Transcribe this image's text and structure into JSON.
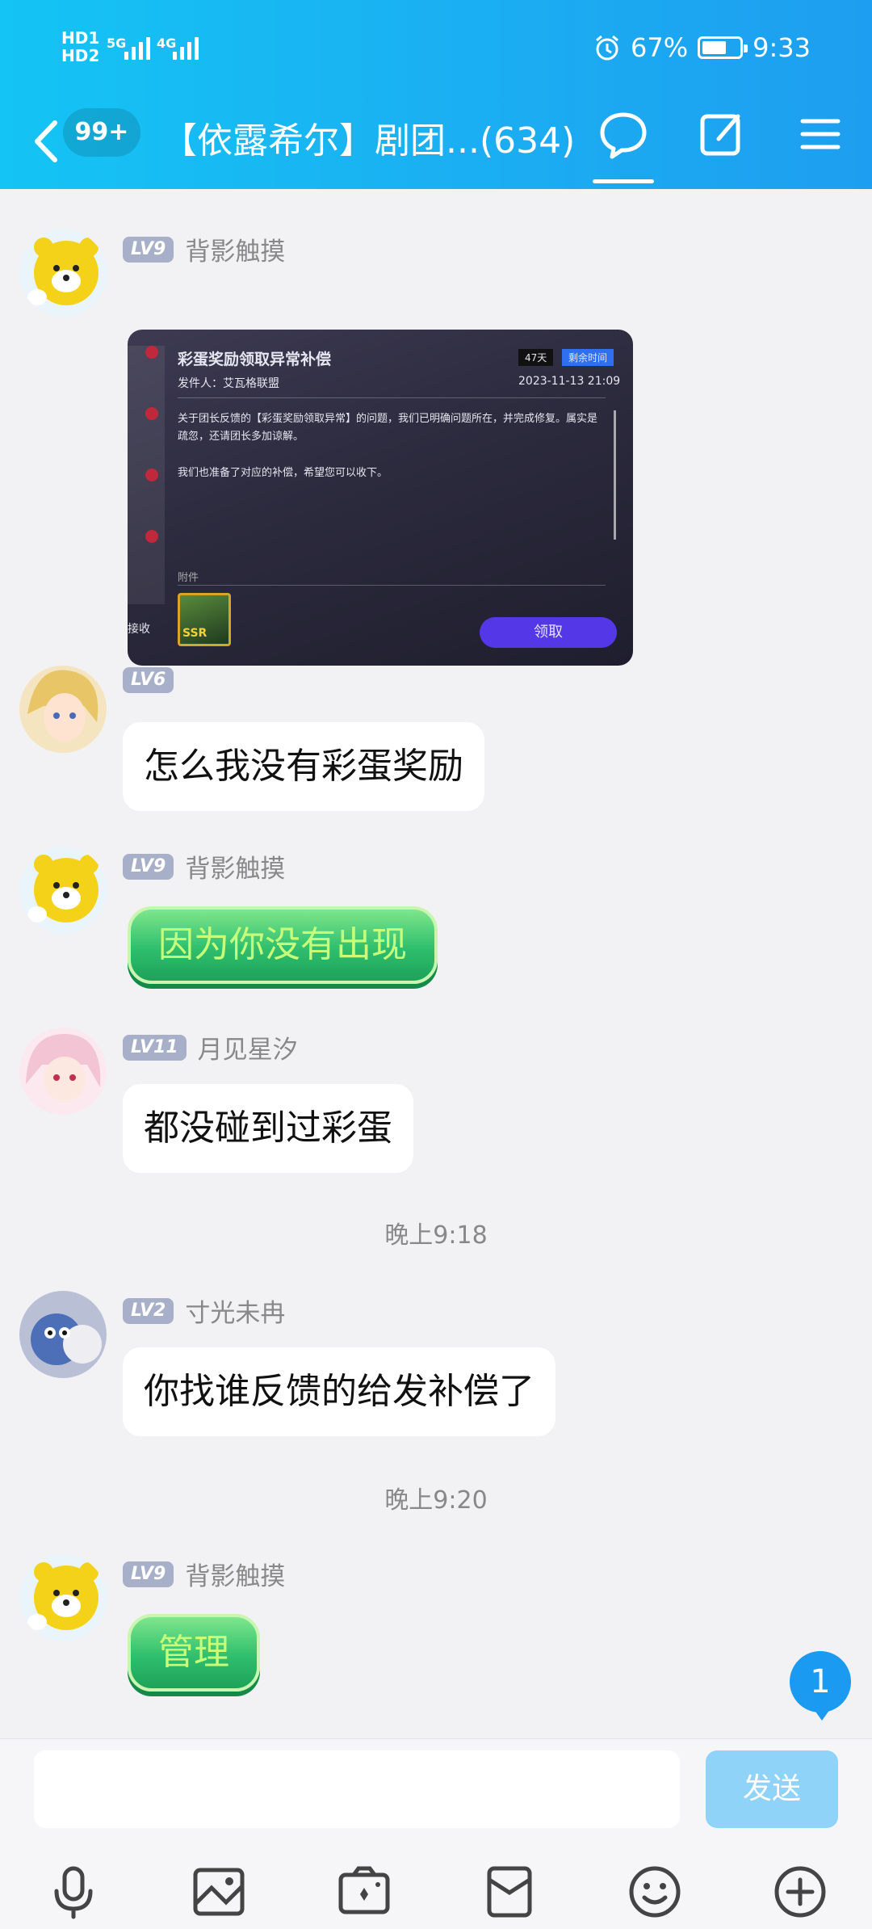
{
  "status": {
    "hd1": "HD1",
    "hd2": "HD2",
    "net1": "5G",
    "net2": "4G",
    "battery": "67%",
    "battery_level": 0.67,
    "time": "9:33"
  },
  "header": {
    "unread_badge": "99+",
    "title": "【依露希尔】剧团...(634)"
  },
  "messages": [
    {
      "level": "LV9",
      "name": "背影触摸",
      "image": {
        "title": "彩蛋奖励领取异常补偿",
        "sender": "发件人：艾瓦格联盟",
        "days": "47天",
        "remain": "剩余时间",
        "date": "2023-11-13 21:09",
        "body1": "关于团长反馈的【彩蛋奖励领取异常】的问题，我们已明确问题所在，并完成修复。属实是疏忽，还请团长多加谅解。",
        "body2": "我们也准备了对应的补偿，希望您可以收下。",
        "attachment": "附件",
        "item_label": "SSR",
        "receive": "接收",
        "claim": "领取"
      }
    },
    {
      "level": "LV6",
      "name": "",
      "text": "怎么我没有彩蛋奖励"
    },
    {
      "level": "LV9",
      "name": "背影触摸",
      "text": "因为你没有出现"
    },
    {
      "level": "LV11",
      "name": "月见星汐",
      "text": "都没碰到过彩蛋"
    },
    {
      "level": "LV2",
      "name": "寸光未冉",
      "text": "你找谁反馈的给发补偿了"
    },
    {
      "level": "LV9",
      "name": "背影触摸",
      "text": "管理"
    }
  ],
  "timestamps": [
    "晚上9:18",
    "晚上9:20"
  ],
  "unread_count": "1",
  "input": {
    "placeholder": "",
    "send_label": "发送"
  },
  "colors": {
    "header_start": "#14c4f4",
    "header_end": "#1e9ef0",
    "send_disabled": "#8fd3f8"
  }
}
